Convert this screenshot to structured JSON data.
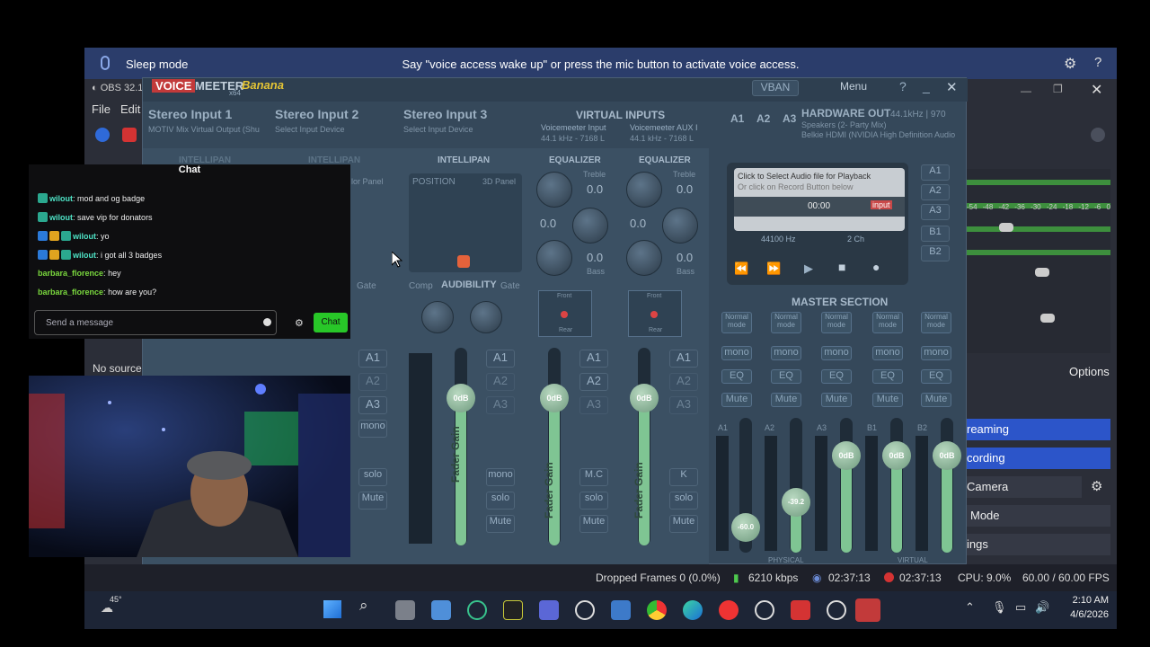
{
  "voice_access": {
    "sleep_label": "Sleep mode",
    "message": "Say \"voice access wake up\" or press the mic button to activate voice access."
  },
  "obs": {
    "title": "OBS 32.1",
    "menu": [
      "File",
      "Edit"
    ],
    "no_source": "No source",
    "options_label": "Options",
    "controls": [
      "reaming",
      "cording",
      "Camera",
      "Mode",
      "ings"
    ],
    "meter_ticks": [
      "-54",
      "-48",
      "-42",
      "-36",
      "-30",
      "-24",
      "-18",
      "-12",
      "-6",
      "0"
    ]
  },
  "voicemeeter": {
    "logo_voice": "VOICE",
    "logo_meeter": "MEETER",
    "logo_banana": "Banana",
    "logo_x64": "x64",
    "vban_label": "VBAN",
    "menu_label": "Menu",
    "inputs": [
      {
        "title": "Stereo Input 1",
        "device": "MOTIV Mix Virtual Output (Shu"
      },
      {
        "title": "Stereo Input 2",
        "device": "Select Input Device"
      },
      {
        "title": "Stereo Input 3",
        "device": "Select Input Device"
      }
    ],
    "virtual_inputs": {
      "title": "VIRTUAL INPUTS",
      "vi1_name": "Voicemeeter Input",
      "vi1_rate": "44.1 kHz - 7168 L",
      "vi2_name": "Voicemeeter AUX I",
      "vi2_rate": "44.1 kHz - 7168 L"
    },
    "hardware_out": {
      "title": "HARDWARE OUT",
      "rate": "44.1kHz | 970",
      "line1": "Speakers (2- Party Mix)",
      "line2": "Belkie HDMI (NVIDIA High Definition Audio"
    },
    "bus_labels": [
      "A1",
      "A2",
      "A3"
    ],
    "intellipan": "INTELLIPAN",
    "position": "POSITION",
    "panel_3d": "3D Panel",
    "color_panel": "lor Panel",
    "comp": "Comp",
    "gate": "Gate",
    "audibility": "AUDIBILITY",
    "equalizer": "EQUALIZER",
    "treble": "Treble",
    "bass": "Bass",
    "eq_value": "0.0",
    "fader_gain": "Fader Gain",
    "zero_db": "0dB",
    "front": "Front",
    "rear": "Rear",
    "strip_buttons": [
      "mono",
      "solo",
      "Mute"
    ],
    "mc_label": "M.C",
    "k_label": "K",
    "cassette": {
      "line1": "Click to Select Audio file for Playback",
      "line2": "Or click on Record Button below",
      "time": "00:00",
      "input": "input",
      "rate": "44100 Hz",
      "channels": "2 Ch"
    },
    "master_section": "MASTER SECTION",
    "master_mode": "Normal mode",
    "master_buttons": [
      "mono",
      "EQ",
      "Mute"
    ],
    "master_bus_labels": [
      "A1",
      "A2",
      "A3",
      "B1",
      "B2"
    ],
    "master_values": [
      "-60.0",
      "-39.2",
      "0dB",
      "0dB",
      "0dB"
    ],
    "physical": "PHYSICAL",
    "virtual": "VIRTUAL",
    "out_buses": [
      "A1",
      "A2",
      "A3",
      "B1",
      "B2"
    ]
  },
  "chat": {
    "title": "Chat",
    "messages": [
      {
        "user": "wilout",
        "text": "mod and og badge",
        "badges": 1
      },
      {
        "user": "wilout",
        "text": "save vip for donators",
        "badges": 1
      },
      {
        "user": "wilout",
        "text": "yo",
        "badges": 3
      },
      {
        "user": "wilout",
        "text": "i got all 3 badges",
        "badges": 3
      },
      {
        "user": "barbara_florence",
        "text": "hey",
        "badges": 0
      },
      {
        "user": "barbara_florence",
        "text": "how are you?",
        "badges": 0
      }
    ],
    "placeholder": "Send a message",
    "send_label": "Chat"
  },
  "status": {
    "dropped": "Dropped Frames 0 (0.0%)",
    "bitrate": "6210 kbps",
    "stream_time": "02:37:13",
    "rec_time": "02:37:13",
    "cpu": "CPU: 9.0%",
    "fps": "60.00 / 60.00 FPS"
  },
  "taskbar": {
    "weather": "45°",
    "time": "2:10 AM",
    "date": "4/6/2026"
  },
  "colors": {
    "voice_access_bg": "#2b3d6b",
    "obs_active": "#2c55c9",
    "chat_send": "#28c728",
    "fader_green": "#7fc593"
  }
}
